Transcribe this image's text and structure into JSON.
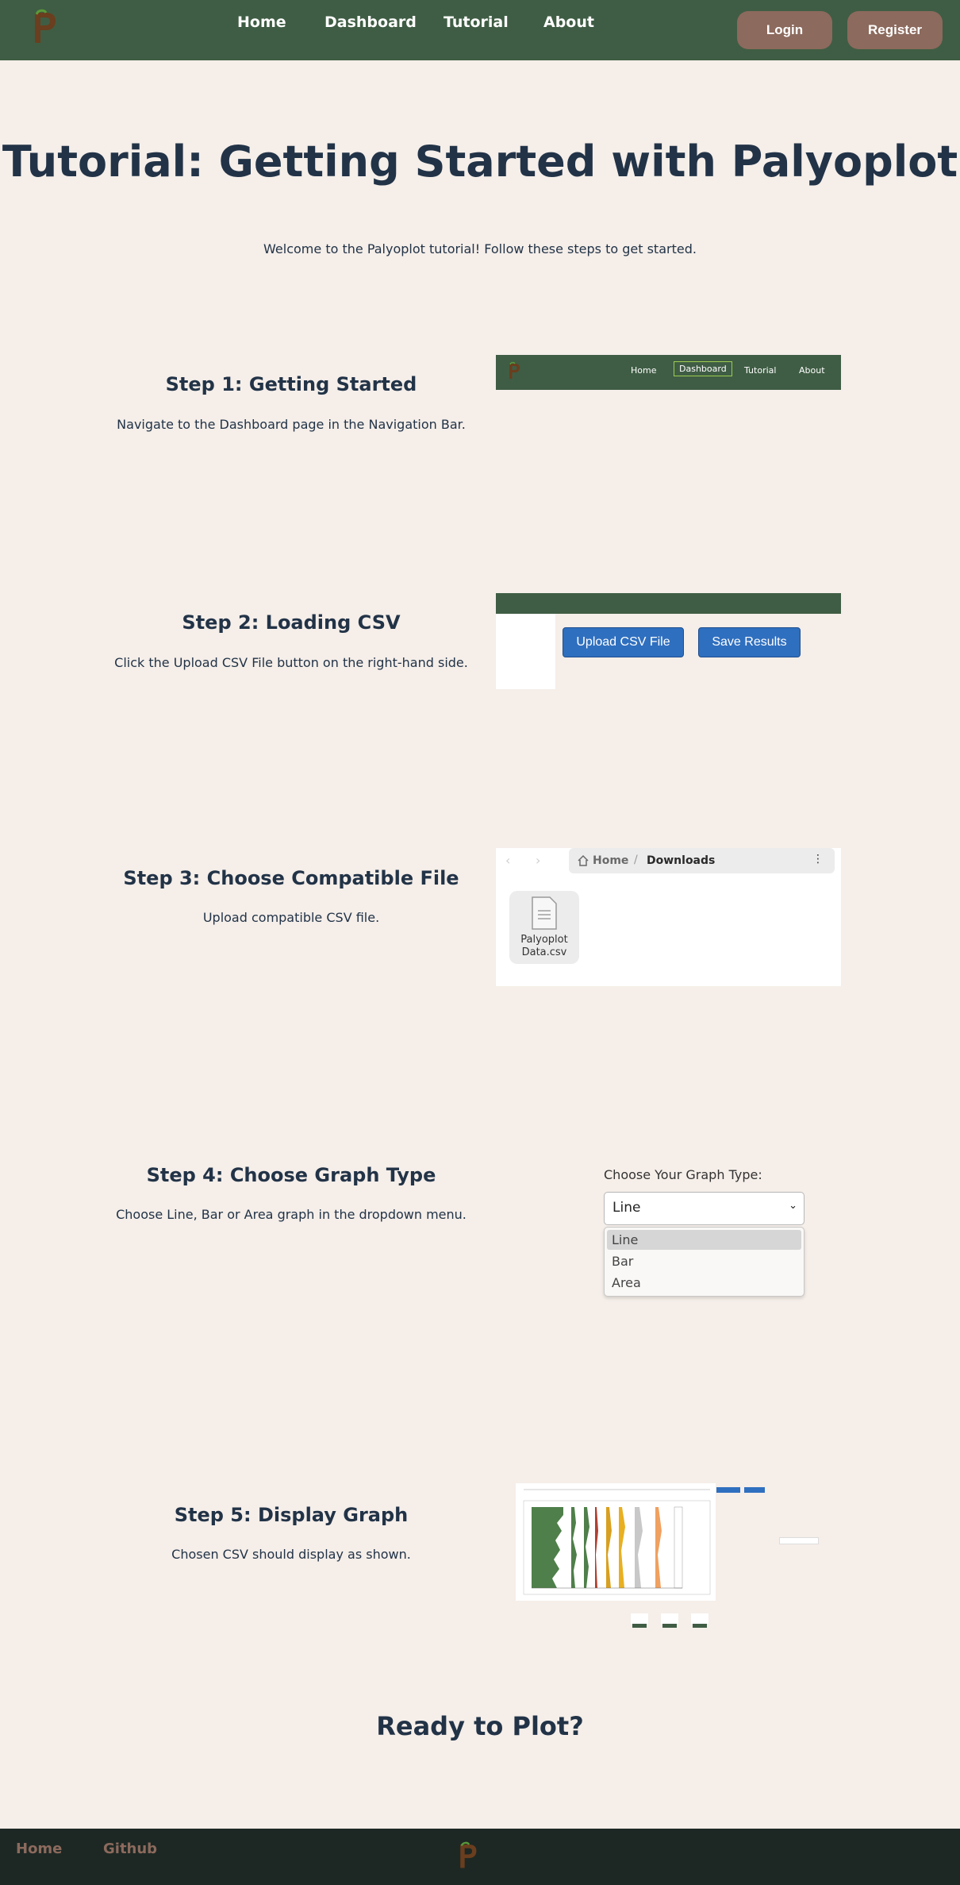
{
  "navbar": {
    "links": [
      "Home",
      "Dashboard",
      "Tutorial",
      "About"
    ],
    "login_label": "Login",
    "register_label": "Register"
  },
  "page": {
    "title": "Tutorial: Getting Started with Palyoplot",
    "intro": "Welcome to the Palyoplot tutorial! Follow these steps to get started.",
    "ready": "Ready to Plot?"
  },
  "steps": [
    {
      "title": "Step 1: Getting Started",
      "desc": "Navigate to the Dashboard page in the Navigation Bar."
    },
    {
      "title": "Step 2: Loading CSV",
      "desc": "Click the Upload CSV File button on the right-hand side."
    },
    {
      "title": "Step 3: Choose Compatible File",
      "desc": "Upload compatible CSV file."
    },
    {
      "title": "Step 4: Choose Graph Type",
      "desc": "Choose Line, Bar or Area graph in the dropdown menu."
    },
    {
      "title": "Step 5: Display Graph",
      "desc": "Chosen CSV should display as shown."
    }
  ],
  "step1_nav": {
    "links": [
      "Home",
      "Dashboard",
      "Tutorial",
      "About"
    ],
    "active": "Dashboard"
  },
  "step2": {
    "upload_label": "Upload CSV File",
    "save_label": "Save Results"
  },
  "step3": {
    "home_label": "Home",
    "sep": "/",
    "folder_label": "Downloads",
    "menu_icon": "⋮",
    "file_name": "Palyoplot Data.csv"
  },
  "step4": {
    "label": "Choose Your Graph Type:",
    "selected": "Line",
    "options": [
      "Line",
      "Bar",
      "Area"
    ]
  },
  "footer": {
    "links": [
      "Home",
      "Github"
    ]
  },
  "colors": {
    "navbar": "#3f5d44",
    "page_bg": "#f5eee9",
    "accent_brown": "#8c6a5d",
    "primary_blue": "#2f6fbf",
    "footer": "#1d2824"
  },
  "icons": {
    "logo": "palyoplot-logo-icon",
    "home": "home-icon",
    "file": "document-icon",
    "back": "chevron-left-icon",
    "forward": "chevron-right-icon",
    "dropdown": "chevron-down-icon"
  }
}
